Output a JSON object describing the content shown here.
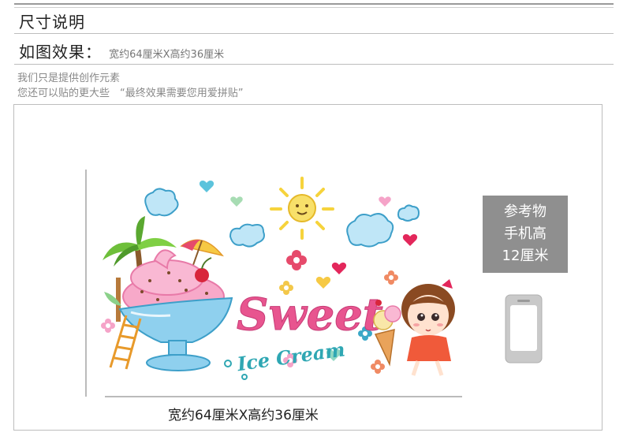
{
  "header": {
    "title": "尺寸说明"
  },
  "subheader": {
    "label": "如图效果：",
    "note": "宽约64厘米X高约36厘米"
  },
  "notes": [
    "我们只是提供创作元素",
    "您还可以贴的更大些　“最终效果需要您用爱拼贴”"
  ],
  "sticker": {
    "word_main": "Sweet",
    "word_sub": "Ice Cream"
  },
  "reference": {
    "lines": [
      "参考物",
      "手机高",
      "12厘米"
    ]
  },
  "dimensions": {
    "label": "宽约64厘米X高约36厘米"
  },
  "colors": {
    "pink": "#e8558f",
    "teal": "#2fa7b3",
    "bowl": "#8fd0ee",
    "ice_cream": "#f7a9c9",
    "sun": "#f6d33c",
    "reference_gray": "#8f8f8f"
  }
}
